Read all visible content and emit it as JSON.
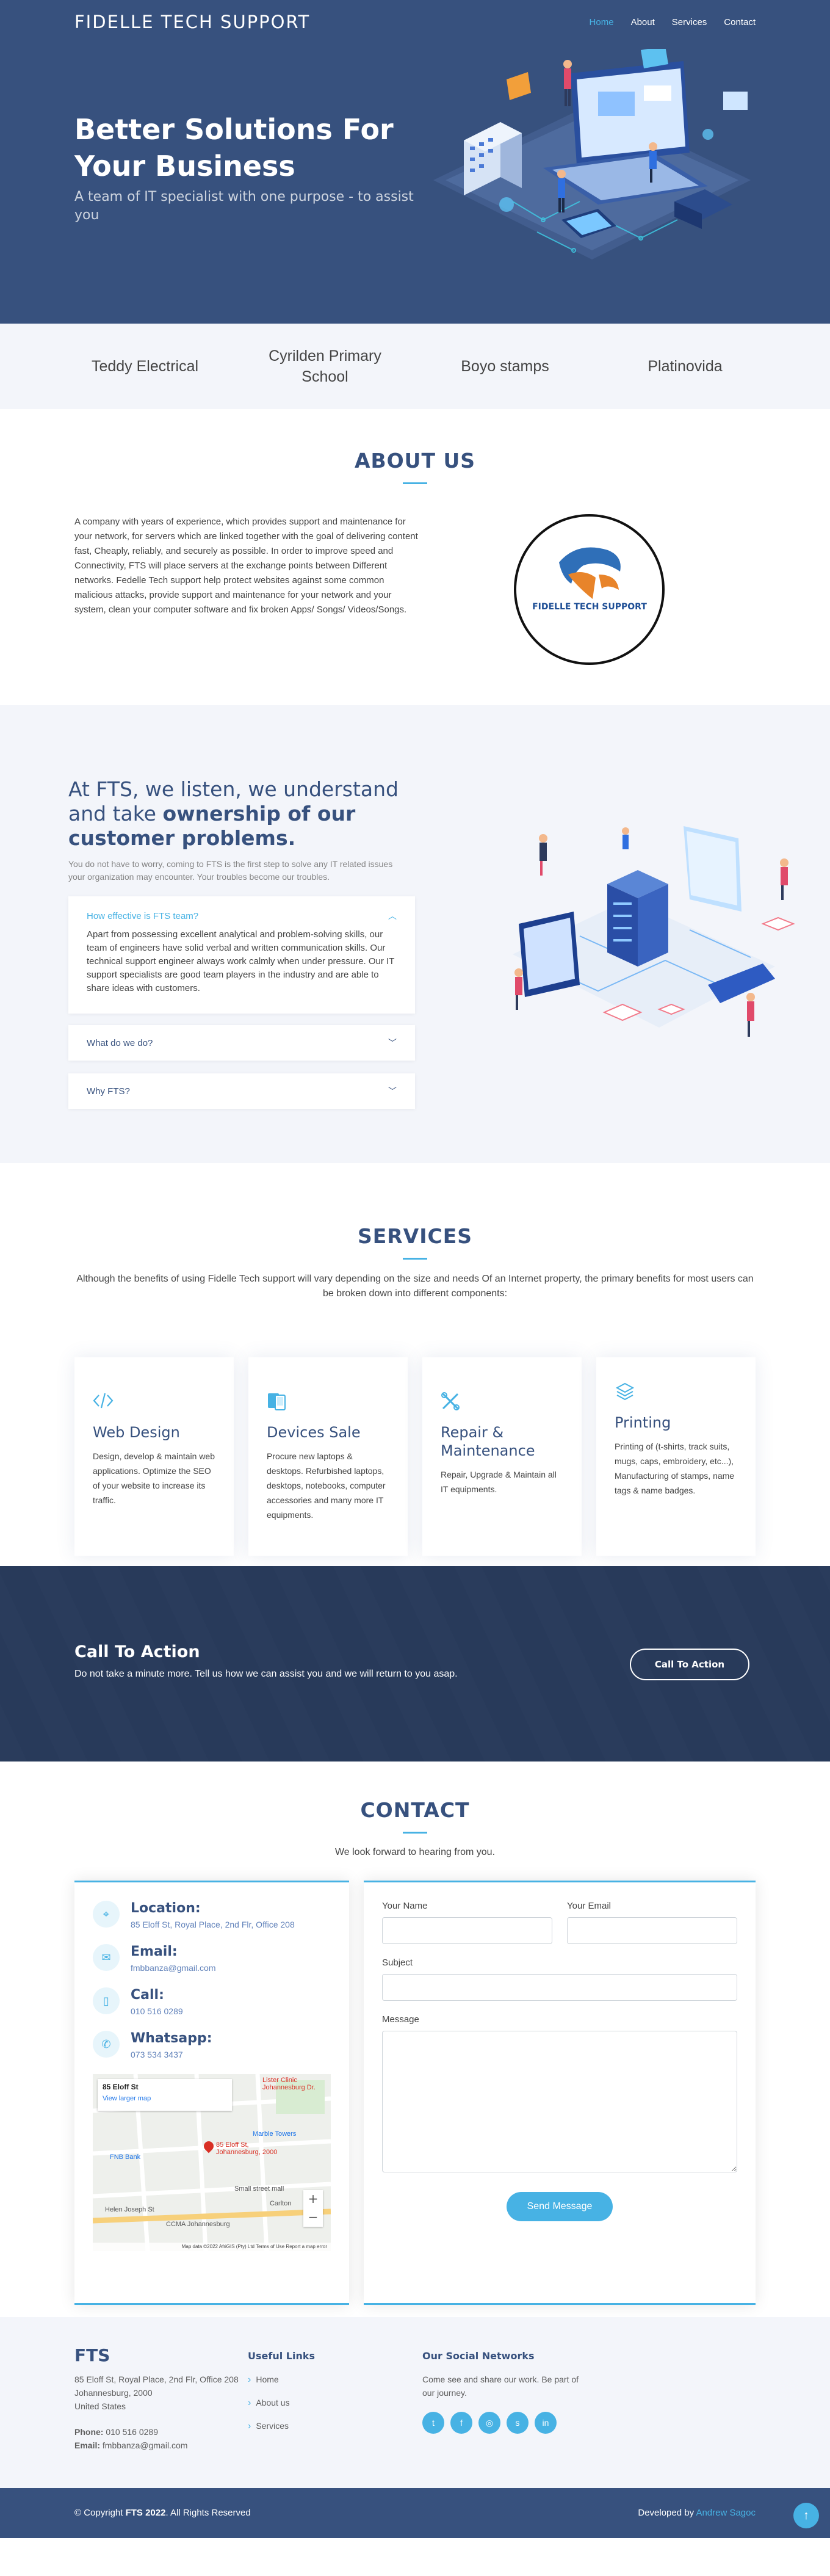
{
  "header": {
    "logo": "FIDELLE TECH SUPPORT",
    "nav": [
      "Home",
      "About",
      "Services",
      "Contact"
    ]
  },
  "hero": {
    "title": "Better Solutions For Your Business",
    "subtitle": "A team of IT specialist with one purpose - to assist you"
  },
  "clients": [
    "Teddy Electrical",
    "Cyrilden Primary School",
    "Boyo stamps",
    "Platinovida"
  ],
  "about": {
    "title": "ABOUT US",
    "text": "A company with years of experience, which provides support and maintenance for your network, for servers which are linked together with the goal of delivering content fast, Cheaply, reliably, and securely as possible. In order to improve speed and Connectivity, FTS will place servers at the exchange points between Different networks. Fedelle Tech support help protect websites against some common malicious attacks, provide support and maintenance for your network and your system, clean your computer software and fix broken Apps/ Songs/ Videos/Songs.",
    "logo_text": "FIDELLE TECH SUPPORT"
  },
  "why": {
    "title_plain": "At FTS, we listen, we understand and take ",
    "title_bold": "ownership of our customer problems.",
    "subtitle": "You do not have to worry, coming to FTS is the first step to solve any IT related issues your organization may encounter. Your troubles become our troubles.",
    "faq": [
      {
        "q": "How effective is FTS team?",
        "a": "Apart from possessing excellent analytical and problem-solving skills, our team of engineers have solid verbal and written communication skills. Our technical support engineer always work calmly when under pressure. Our IT support specialists are good team players in the industry and are able to share ideas with customers."
      },
      {
        "q": "What do we do?"
      },
      {
        "q": "Why FTS?"
      }
    ]
  },
  "services": {
    "title": "SERVICES",
    "intro": "Although the benefits of using Fidelle Tech support will vary depending on the size and needs Of an Internet property, the primary benefits for most users can be broken down into different components:",
    "items": [
      {
        "title": "Web Design",
        "text": "Design, develop & maintain web applications. Optimize the SEO of your website to increase its traffic.",
        "icon": "code-icon"
      },
      {
        "title": "Devices Sale",
        "text": "Procure new laptops & desktops. Refurbished laptops, desktops, notebooks, computer accessories and many more IT equipments.",
        "icon": "devices-icon"
      },
      {
        "title": "Repair & Maintenance",
        "text": "Repair, Upgrade & Maintain all IT equipments.",
        "icon": "tools-icon"
      },
      {
        "title": "Printing",
        "text": "Printing of (t-shirts, track suits, mugs, caps, embroidery, etc...), Manufacturing of stamps, name tags & name badges.",
        "icon": "layers-icon"
      }
    ]
  },
  "cta": {
    "title": "Call To Action",
    "text": "Do not take a minute more. Tell us how we can assist you and we will return to you asap.",
    "button": "Call To Action"
  },
  "contact": {
    "title": "CONTACT",
    "subtitle": "We look forward to hearing from you.",
    "location_label": "Location:",
    "location": "85 Eloff St, Royal Place, 2nd Flr, Office 208",
    "email_label": "Email:",
    "email": "fmbbanza@gmail.com",
    "call_label": "Call:",
    "call": "010 516 0289",
    "whatsapp_label": "Whatsapp:",
    "whatsapp": "073 534 3437",
    "map": {
      "place": "85 Eloff St",
      "larger": "View larger map",
      "pin": "85 Eloff St, Johannesburg, 2000",
      "labels": [
        "Lister Clinic Johannesburg Dr.",
        "Marble Towers",
        "FNB Bank",
        "Small street mall",
        "Carlton",
        "Helen Joseph St",
        "CCMA Johannesburg"
      ],
      "footer": "Map data ©2022 AfriGIS (Pty) Ltd  Terms of Use  Report a map error",
      "zoom_in": "+",
      "zoom_out": "−"
    },
    "form": {
      "name": "Your Name",
      "email": "Your Email",
      "subject": "Subject",
      "message": "Message",
      "send": "Send Message"
    }
  },
  "footer": {
    "brand": "FTS",
    "address1": "85 Eloff St, Royal Place, 2nd Flr, Office 208",
    "address2": "Johannesburg, 2000",
    "address3": "United States",
    "phone_label": "Phone:",
    "phone": "010 516 0289",
    "email_label": "Email:",
    "email": "fmbbanza@gmail.com",
    "links_title": "Useful Links",
    "links": [
      "Home",
      "About us",
      "Services"
    ],
    "social_title": "Our Social Networks",
    "social_text": "Come see and share our work. Be part of our journey.",
    "copyright_pre": "© Copyright ",
    "copyright_brand": "FTS 2022",
    "copyright_post": ". All Rights Reserved",
    "developed_by": "Developed by ",
    "developer": "Andrew Sagoc"
  }
}
